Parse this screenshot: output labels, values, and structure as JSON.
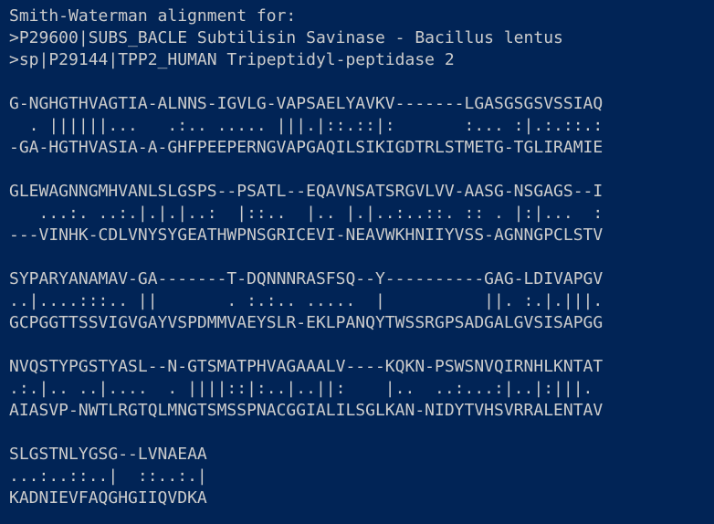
{
  "terminal": {
    "colors": {
      "background": "#012456",
      "foreground": "#cccccc"
    },
    "header": [
      "Smith-Waterman alignment for:",
      ">P29600|SUBS_BACLE Subtilisin Savinase - Bacillus lentus",
      ">sp|P29144|TPP2_HUMAN Tripeptidyl-peptidase 2"
    ],
    "blocks": [
      {
        "top": "G-NGHGTHVAGTIA-ALNNS-IGVLG-VAPSAELYAVKV-------LGASGSGSVSSIAQ",
        "match": "  . ||||||...   .:.. ..... |||.|::.::|:       :... :|.:.::.:",
        "bottom": "-GA-HGTHVASIA-A-GHFPEEPERNGVAPGAQILSIKIGDTRLSTMETG-TGLIRAMIE"
      },
      {
        "top": "GLEWAGNNGMHVANLSLGSPS--PSATL--EQAVNSATSRGVLVV-AASG-NSGAGS--I",
        "match": "   ...:. ..:.|.|.|..:  |::..  |.. |.|..:..::. :: . |:|...  :",
        "bottom": "---VINHK-CDLVNYSYGEATHWPNSGRICEVI-NEAVWKHNIIYVSS-AGNNGPCLSTV"
      },
      {
        "top": "SYPARYANAMAV-GA-------T-DQNNNRASFSQ--Y----------GAG-LDIVAPGV",
        "match": "..|....:::.. ||       . :.:.. .....  |          ||. :.|.|||.",
        "bottom": "GCPGGTTSSVIGVGAYVSPDMMVAEYSLR-EKLPANQYTWSSRGPSADGALGVSISAPGG"
      },
      {
        "top": "NVQSTYPGSTYASL--N-GTSMATPHVAGAAALV----KQKN-PSWSNVQIRNHLKNTAT",
        "match": ".:.|.. ..|....  . ||||::|:..|..||:    |..  ..:...:|..|:|||.",
        "bottom": "AIASVP-NWTLRGTQLMNGTSMSSPNACGGIALILSGLKAN-NIDYTVHSVRRALENTAV"
      },
      {
        "top": "SLGSTNLYGSG--LVNAEAA",
        "match": "...:..::..|  ::..:.|",
        "bottom": "KADNIEVFAQGHGIIQVDKA"
      }
    ]
  }
}
